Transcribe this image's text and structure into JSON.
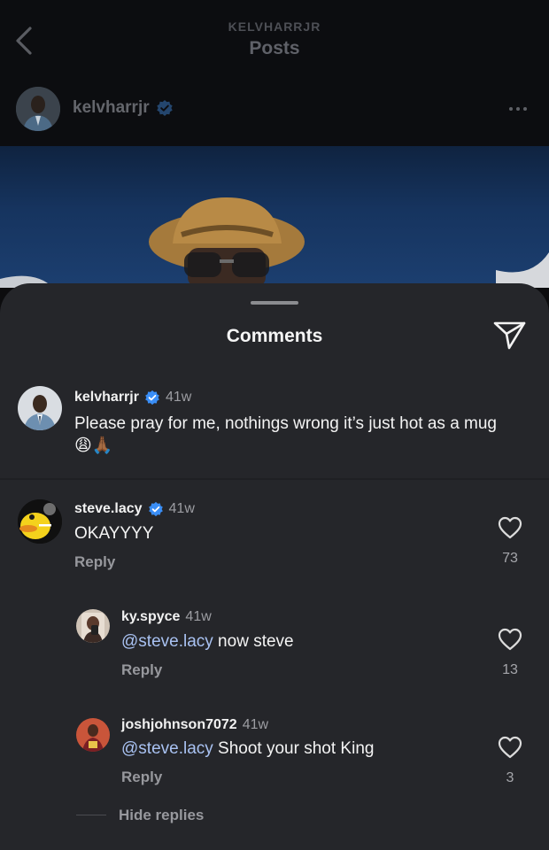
{
  "background": {
    "kicker": "KELVHARRJR",
    "title": "Posts",
    "username": "kelvharrjr"
  },
  "sheet": {
    "title": "Comments"
  },
  "caption": {
    "username": "kelvharrjr",
    "time": "41w",
    "text": "Please pray for me, nothings wrong it’s just hot as a mug",
    "emoji": "😩🙏🏾"
  },
  "comments": [
    {
      "username": "steve.lacy",
      "time": "41w",
      "mention": "",
      "text": "OKAYYYY",
      "reply_label": "Reply",
      "likes": "73"
    },
    {
      "username": "ky.spyce",
      "time": "41w",
      "mention": "@steve.lacy",
      "text": " now steve",
      "reply_label": "Reply",
      "likes": "13"
    },
    {
      "username": "joshjohnson7072",
      "time": "41w",
      "mention": "@steve.lacy",
      "text": " Shoot your shot King",
      "reply_label": "Reply",
      "likes": "3"
    }
  ],
  "hide_replies_label": "Hide replies",
  "icons": {
    "back": "chevron-left-icon",
    "verified": "verified-badge-icon",
    "more": "more-horizontal-icon",
    "share": "send-icon",
    "like": "heart-icon"
  },
  "colors": {
    "sheet_bg": "#25262a",
    "mention": "#a9c2f2",
    "verified": "#3a8ef6"
  }
}
